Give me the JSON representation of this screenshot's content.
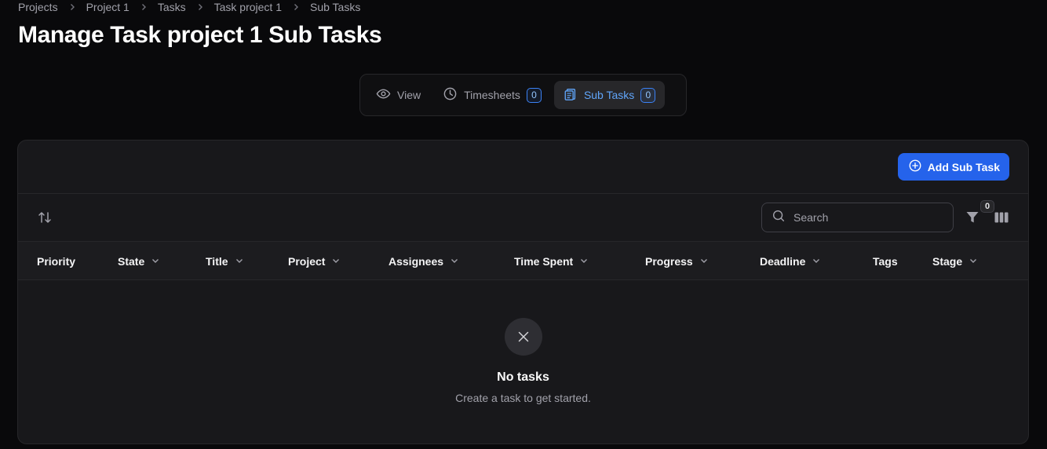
{
  "breadcrumb": [
    "Projects",
    "Project 1",
    "Tasks",
    "Task project 1",
    "Sub Tasks"
  ],
  "page_title": "Manage Task project 1 Sub Tasks",
  "tabs": [
    {
      "label": "View",
      "icon": "eye-icon"
    },
    {
      "label": "Timesheets",
      "icon": "clock-icon",
      "count": "0"
    },
    {
      "label": "Sub Tasks",
      "icon": "clipboard-icon",
      "count": "0",
      "active": true
    }
  ],
  "header": {
    "add_button_label": "Add Sub Task",
    "add_button_icon": "plus-circle-icon"
  },
  "toolbar": {
    "sort_icon": "sort-arrows-icon",
    "search_placeholder": "Search",
    "search_value": "",
    "filter_icon": "funnel-icon",
    "filter_count": "0",
    "columns_icon": "columns-icon"
  },
  "columns": [
    {
      "label": "Priority",
      "sortable": false
    },
    {
      "label": "State",
      "sortable": true
    },
    {
      "label": "Title",
      "sortable": true
    },
    {
      "label": "Project",
      "sortable": true
    },
    {
      "label": "Assignees",
      "sortable": true
    },
    {
      "label": "Time Spent",
      "sortable": true
    },
    {
      "label": "Progress",
      "sortable": true
    },
    {
      "label": "Deadline",
      "sortable": true
    },
    {
      "label": "Tags",
      "sortable": false
    },
    {
      "label": "Stage",
      "sortable": true
    }
  ],
  "empty_state": {
    "icon": "x-icon",
    "title": "No tasks",
    "description": "Create a task to get started."
  },
  "colors": {
    "background": "#09090b",
    "panel": "#18181b",
    "accent": "#2563eb",
    "active_tab_text": "#60a5fa"
  }
}
